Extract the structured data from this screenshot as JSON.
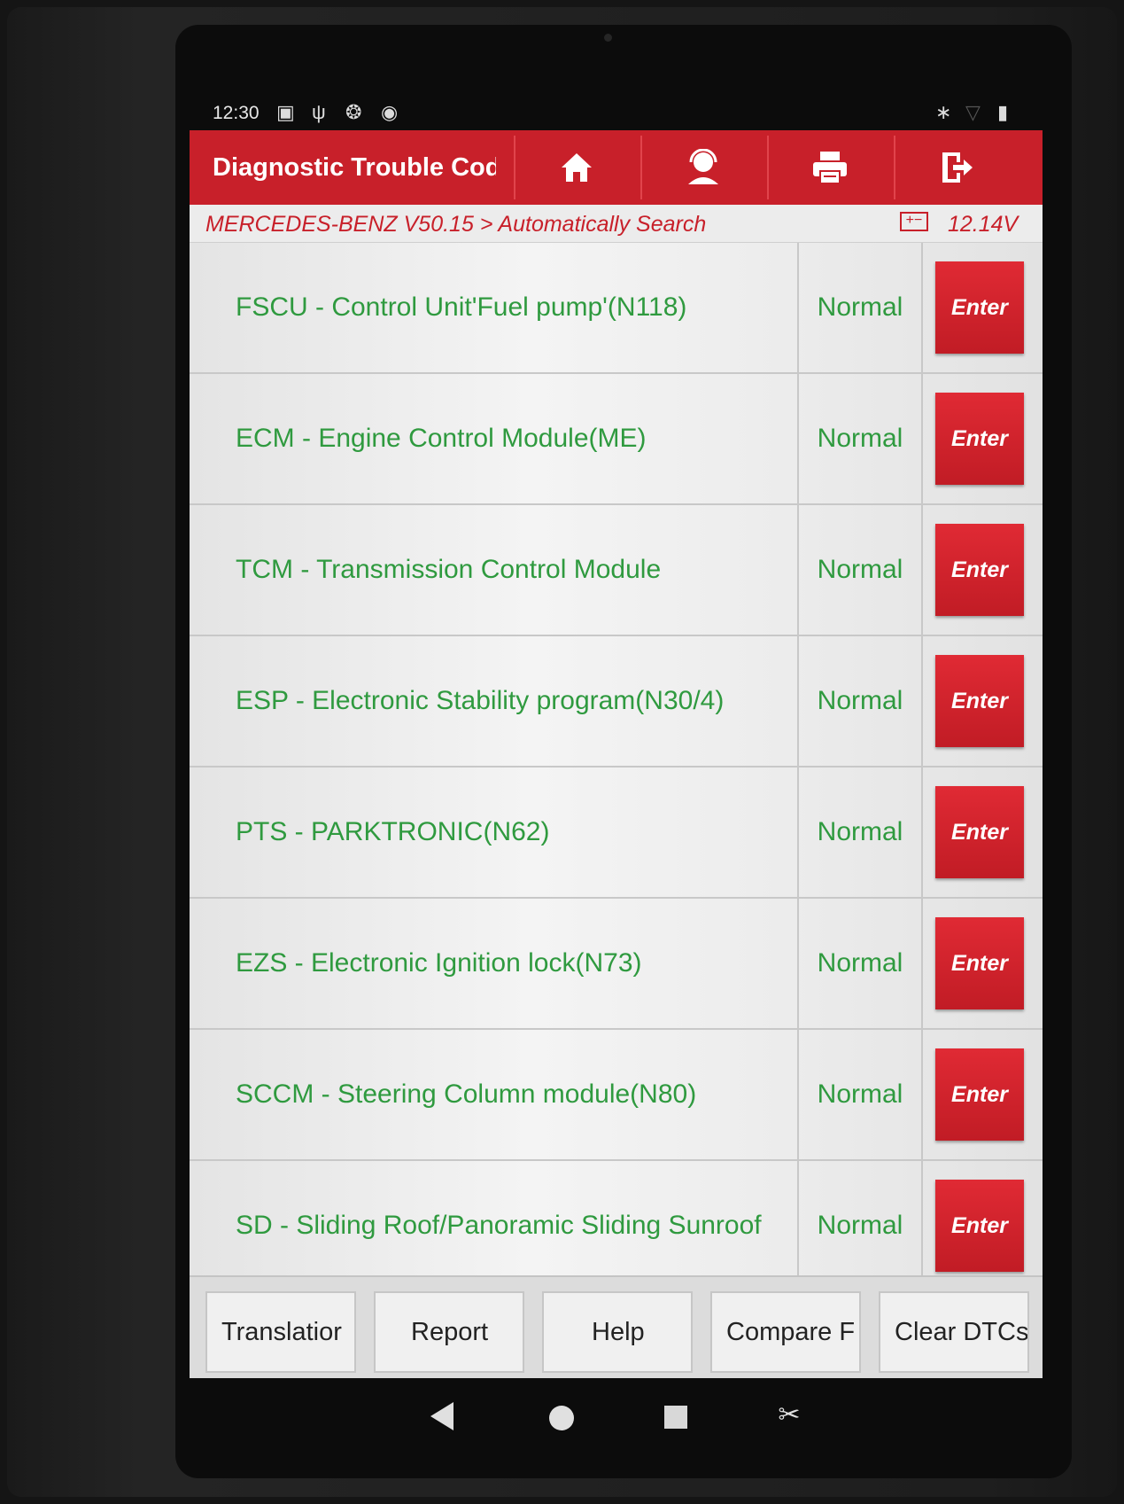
{
  "status_bar": {
    "time": "12:30",
    "icons": [
      "image-icon",
      "stethoscope-icon",
      "settings-icon",
      "shield-icon",
      "bluetooth-icon",
      "wifi-icon",
      "battery-icon"
    ]
  },
  "header": {
    "title": "Diagnostic Trouble Cod",
    "buttons": [
      "home-icon",
      "support-icon",
      "print-icon",
      "exit-icon"
    ]
  },
  "breadcrumb": {
    "text": "MERCEDES-BENZ V50.15 > Automatically Search",
    "voltage": "12.14V"
  },
  "modules": [
    {
      "name": "FSCU - Control Unit'Fuel pump'(N118)",
      "status": "Normal",
      "action": "Enter"
    },
    {
      "name": "ECM - Engine Control Module(ME)",
      "status": "Normal",
      "action": "Enter"
    },
    {
      "name": "TCM - Transmission Control Module",
      "status": "Normal",
      "action": "Enter"
    },
    {
      "name": "ESP - Electronic Stability program(N30/4)",
      "status": "Normal",
      "action": "Enter"
    },
    {
      "name": "PTS - PARKTRONIC(N62)",
      "status": "Normal",
      "action": "Enter"
    },
    {
      "name": "EZS - Electronic Ignition lock(N73)",
      "status": "Normal",
      "action": "Enter"
    },
    {
      "name": "SCCM - Steering Column module(N80)",
      "status": "Normal",
      "action": "Enter"
    },
    {
      "name": "SD - Sliding Roof/Panoramic Sliding Sunroof",
      "status": "Normal",
      "action": "Enter"
    }
  ],
  "footer": {
    "translation": "Translatior",
    "report": "Report",
    "help": "Help",
    "compare": "Compare F",
    "clear_dtcs": "Clear DTCs"
  },
  "colors": {
    "brand_red": "#c8202a",
    "status_green": "#2f9a3f"
  }
}
